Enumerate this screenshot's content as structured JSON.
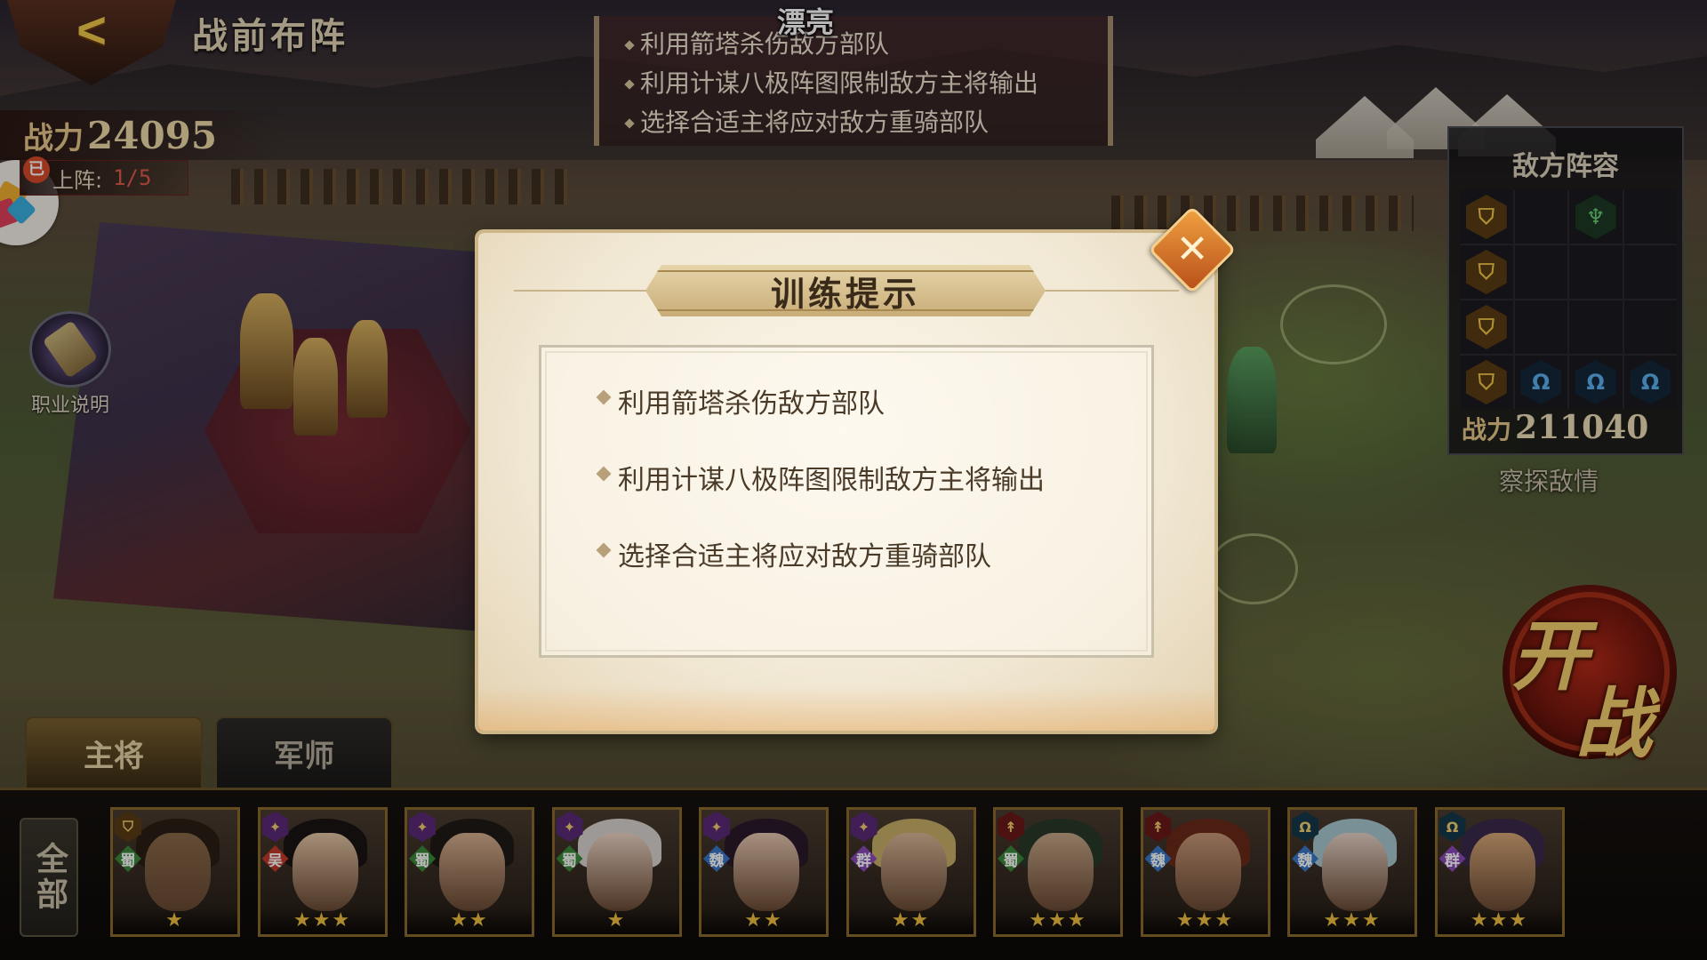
{
  "header": {
    "back_label": "<",
    "title": "战前布阵",
    "power_label": "战力",
    "power_value": "24095",
    "deploy_badge": "已",
    "deploy_label": "上阵:",
    "deploy_count": "1/5",
    "job_label": "职业说明"
  },
  "float_text": "漂亮",
  "top_hints": [
    "利用箭塔杀伤敌方部队",
    "利用计谋八极阵图限制敌方主将输出",
    "选择合适主将应对敌方重骑部队"
  ],
  "enemy_panel": {
    "title": "敌方阵容",
    "grid": [
      [
        "shield",
        "",
        "archer",
        ""
      ],
      [
        "shield",
        "",
        "",
        ""
      ],
      [
        "shield",
        "",
        "",
        ""
      ],
      [
        "shield",
        "cavalry",
        "cavalry",
        "cavalry"
      ]
    ],
    "power_label": "战力",
    "power_value": "211040",
    "scout_label": "察探敌情"
  },
  "start_button": {
    "char1": "开",
    "char2": "战"
  },
  "tabs": [
    {
      "label": "主将",
      "active": true
    },
    {
      "label": "军师",
      "active": false
    }
  ],
  "filter_all": "全部",
  "heroes": [
    {
      "type": "shield",
      "faction": "蜀",
      "faction_color": "#3a8a3a",
      "stars": "★",
      "skin": "#8a6a4a",
      "hair": "#2a1e16"
    },
    {
      "type": "magic",
      "faction": "吴",
      "faction_color": "#c23a2a",
      "stars": "★★★",
      "skin": "#e6c6a6",
      "hair": "#1a1414"
    },
    {
      "type": "magic",
      "faction": "蜀",
      "faction_color": "#3a8a3a",
      "stars": "★★",
      "skin": "#d8b090",
      "hair": "#1e1a16"
    },
    {
      "type": "magic",
      "faction": "蜀",
      "faction_color": "#3a8a3a",
      "stars": "★",
      "skin": "#eed6c6",
      "hair": "#d8d4d0"
    },
    {
      "type": "magic",
      "faction": "魏",
      "faction_color": "#3a78c8",
      "stars": "★★",
      "skin": "#e8c8b0",
      "hair": "#2a1a2a"
    },
    {
      "type": "magic",
      "faction": "群",
      "faction_color": "#8a4ab8",
      "stars": "★★",
      "skin": "#d8b898",
      "hair": "#c8b068"
    },
    {
      "type": "spear",
      "faction": "蜀",
      "faction_color": "#3a8a3a",
      "stars": "★★★",
      "skin": "#c8a888",
      "hair": "#2a3a2a"
    },
    {
      "type": "spear",
      "faction": "魏",
      "faction_color": "#3a78c8",
      "stars": "★★★",
      "skin": "#c89878",
      "hair": "#6a2a1a"
    },
    {
      "type": "cavalry",
      "faction": "魏",
      "faction_color": "#3a78c8",
      "stars": "★★★",
      "skin": "#e8d4c8",
      "hair": "#a8c8d0"
    },
    {
      "type": "cavalry",
      "faction": "群",
      "faction_color": "#8a4ab8",
      "stars": "★★★",
      "skin": "#d8a878",
      "hair": "#3a2a4a"
    }
  ],
  "modal": {
    "title": "训练提示",
    "close_label": "✕",
    "hints": [
      "利用箭塔杀伤敌方部队",
      "利用计谋八极阵图限制敌方主将输出",
      "选择合适主将应对敌方重骑部队"
    ]
  },
  "colors": {
    "shield": "#5a3c14",
    "magic": "#5a2a78",
    "spear": "#6a1a1a",
    "cavalry": "#14384a"
  }
}
